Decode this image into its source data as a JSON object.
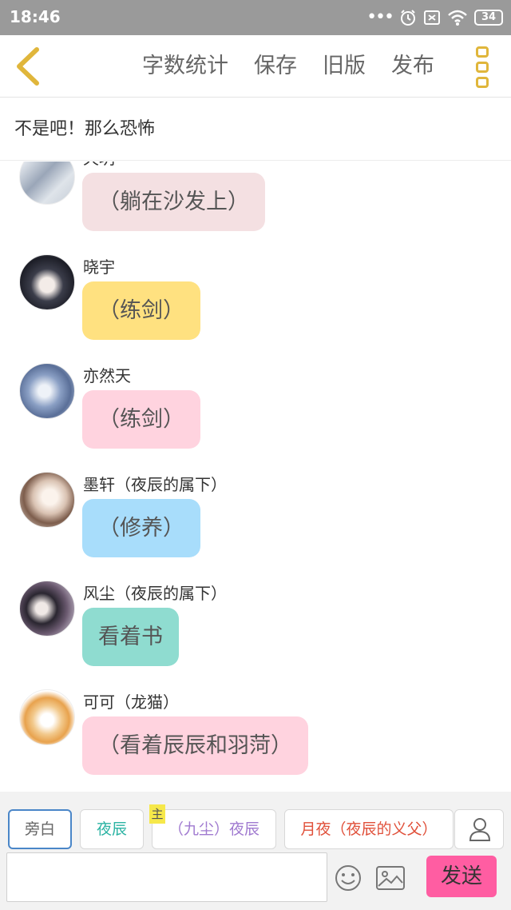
{
  "status_bar": {
    "time": "18:46",
    "battery": "34"
  },
  "toolbar": {
    "word_count": "字数统计",
    "save": "保存",
    "old_version": "旧版",
    "publish": "发布"
  },
  "chapter": {
    "title": "不是吧！那么恐怖"
  },
  "messages": [
    {
      "speaker": "天玥",
      "text": "（躺在沙发上）",
      "bubble_color": "#f4e0e2"
    },
    {
      "speaker": "晓宇",
      "text": "（练剑）",
      "bubble_color": "#ffe180"
    },
    {
      "speaker": "亦然天",
      "text": "（练剑）",
      "bubble_color": "#ffd3df"
    },
    {
      "speaker": "墨轩（夜辰的属下）",
      "text": "（修养）",
      "bubble_color": "#a8ddfb"
    },
    {
      "speaker": "风尘（夜辰的属下）",
      "text": "看着书",
      "bubble_color": "#8fdcd0"
    },
    {
      "speaker": "可可（龙猫）",
      "text": "（看着辰辰和羽菏）",
      "bubble_color": "#ffd3df"
    }
  ],
  "roles": [
    {
      "label": "旁白",
      "color": "#666666"
    },
    {
      "label": "夜辰",
      "color": "#2bb3a3"
    },
    {
      "label": "（九尘）夜辰",
      "color": "#a07ad0"
    },
    {
      "label": "月夜（夜辰的义父）",
      "color": "#e0503a"
    }
  ],
  "owner_badge": "主",
  "input": {
    "value": ""
  },
  "send_label": "发送"
}
